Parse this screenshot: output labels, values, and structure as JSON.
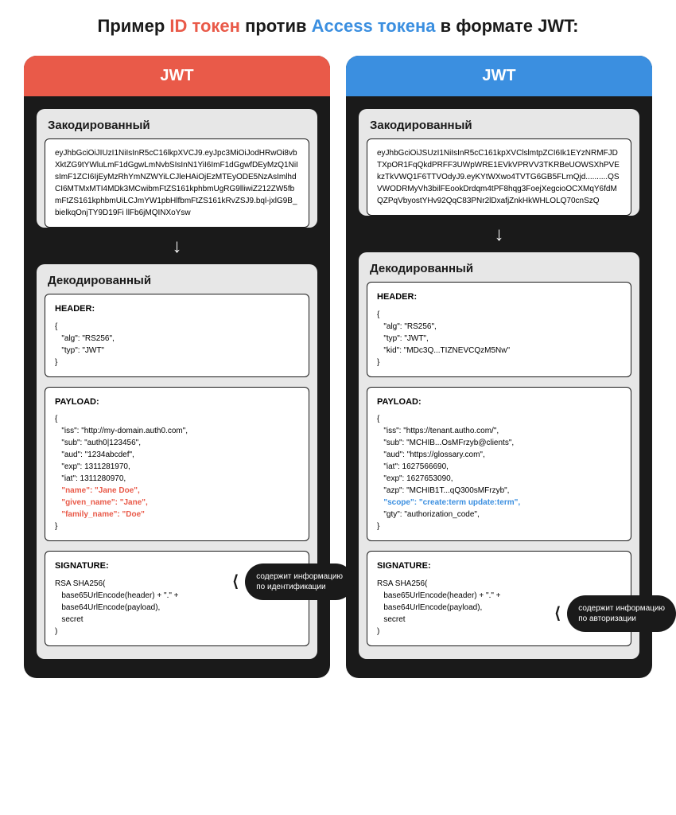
{
  "title_parts": {
    "prefix": "Пример ",
    "id_token": "ID токен",
    "mid": " против ",
    "access_token": "Access токена",
    "suffix": " в формате JWT:"
  },
  "labels": {
    "jwt": "JWT",
    "encoded": "Закодированный",
    "decoded": "Декодированный",
    "header": "HEADER:",
    "payload": "PAYLOAD:",
    "signature": "SIGNATURE:"
  },
  "left": {
    "encoded_text": "eyJhbGciOiJIUzI1NiIsInR5cC16lkpXVCJ9.eyJpc3MiOiJodHRwOi8vbXktZG9tYWluLmF1dGgwLmNvbSIsInN1YiI6ImF1dGgwfDEyMzQ1NiIsImF1ZCI6IjEyMzRhYmNZWYiLCJleHAiOjEzMTEyODE5NzAsImlhdCI6MTMxMTI4MDk3MCwibmFtZS161kphbmUgRG9lliwiZ212ZW5fbmFtZS161kphbmUiLCJmYW1pbHlfbmFtZS161kRvZSJ9.bql-jxlG9B_bielkqOnjTY9D19Fi llFb6jMQINXoYsw",
    "header_lines": [
      "{",
      "   \"alg\": \"RS256\",",
      "   \"typ\": \"JWT\"",
      "}"
    ],
    "payload_lines": [
      "{",
      "   \"iss\": \"http://my-domain.auth0.com\",",
      "   \"sub\": \"auth0|123456\",",
      "   \"aud\": \"1234abcdef\",",
      "   \"exp\": 1311281970,",
      "   \"iat\": 1311280970,"
    ],
    "payload_highlight": [
      "   \"name\": \"Jane Doe\",",
      "   \"given_name\": \"Jane\",",
      "   \"family_name\": \"Doe\""
    ],
    "payload_close": "}",
    "signature_lines": [
      "RSA SHA256(",
      "   base65UrlEncode(header) + \".\" +",
      "   base64UrlEncode(payload),",
      "   secret",
      ")"
    ],
    "callout_line1": "содержит информацию",
    "callout_line2": "по идентификации"
  },
  "right": {
    "encoded_text": "eyJhbGciOiJSUzI1NiIsInR5cC161kpXVClslmtpZCI6Ik1EYzNRMFJDTXpOR1FqQkdPRFF3UWpWRE1EVkVPRVV3TKRBeUOWSXhPVEkzTkVWQ1F6TTVOdyJ9.eyKYtWXwo4TVTG6GB5FLrnQjd..........QSVWODRMyVh3bilFEookDrdqm4tPF8hqg3FoejXegcioOCXMqY6fdMQZPqVbyostYHv92QqC83PNr2lDxafjZnkHkWHLOLQ70cnSzQ",
    "header_lines": [
      "{",
      "   \"alg\": \"RS256\",",
      "   \"typ\": \"JWT\",",
      "   \"kid\": \"MDc3Q...TIZNEVCQzM5Nw\"",
      "}"
    ],
    "payload_lines": [
      "{",
      "   \"iss\": \"https://tenant.autho.com/\",",
      "   \"sub\": \"MCHIB...OsMFrzyb@clients\",",
      "   \"aud\": \"https://glossary.com\",",
      "   \"iat\": 1627566690,",
      "   \"exp\": 1627653090,",
      "   \"azp\": \"MCHIB1T...qQ300sMFrzyb\","
    ],
    "payload_highlight": [
      "   \"scope\": \"create:term update:term\","
    ],
    "payload_after": [
      "   \"gty\": \"authorization_code\","
    ],
    "payload_close": "}",
    "signature_lines": [
      "RSA SHA256(",
      "   base65UrlEncode(header) + \".\" +",
      "   base64UrlEncode(payload),",
      "   secret",
      ")"
    ],
    "callout_line1": "содержит информацию",
    "callout_line2": "по авторизации"
  }
}
